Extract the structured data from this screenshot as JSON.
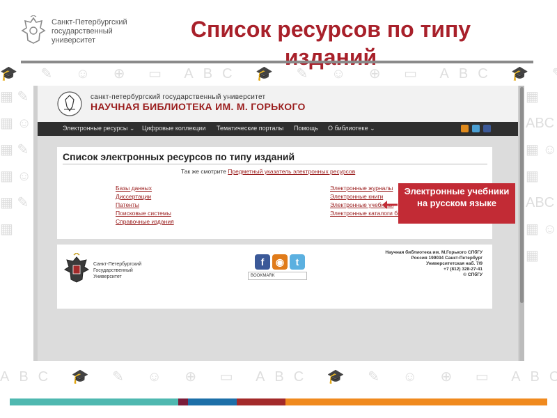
{
  "slide": {
    "logo_lines": [
      "Санкт-Петербургский",
      "государственный",
      "университет"
    ],
    "title": "Список ресурсов по типу изданий"
  },
  "library_site": {
    "header_university": "санкт-петербургский государственный университет",
    "header_library": "НАУЧНАЯ БИБЛИОТЕКА ИМ. М. ГОРЬКОГО",
    "nav": [
      {
        "label": "Электронные ресурсы ⌄"
      },
      {
        "label": "Цифровые коллекции"
      },
      {
        "label": "Тематические порталы"
      },
      {
        "label": "Помощь"
      },
      {
        "label": "О библиотеке ⌄"
      }
    ],
    "page_title": "Список электронных ресурсов по типу изданий",
    "see_also_text": "Так же смотрите",
    "see_also_link": "Предметный указатель электронных ресурсов",
    "left_links": [
      "Базы данных",
      "Диссертации",
      "Патенты",
      "Поисковые системы",
      "Справочные издания"
    ],
    "right_links": [
      "Электронные журналы",
      "Электронные книги",
      "Электронные учебники",
      "Электронные каталоги библ"
    ],
    "footer_univ_lines": [
      "Санкт-Петербургский",
      "Государственный",
      "Университет"
    ],
    "bookmark_label": "BOOKMARK",
    "footer_address": [
      "Научная библиотека им. М.Горького СПбГУ",
      "Россия 199034 Санкт-Петербург",
      "Университетская наб. 7/9",
      "+7 (812) 328-27-41",
      "© СПбГУ"
    ]
  },
  "callout": {
    "text": "Электронные учебники на русском языке",
    "color": "#c22b35"
  },
  "icons": {
    "facebook": "facebook-icon",
    "rss": "rss-icon",
    "twitter": "twitter-icon"
  },
  "stripes": [
    "#4fb8b0",
    "#7a1d3a",
    "#1d6fa8",
    "#a32a2a",
    "#f08a1e"
  ]
}
